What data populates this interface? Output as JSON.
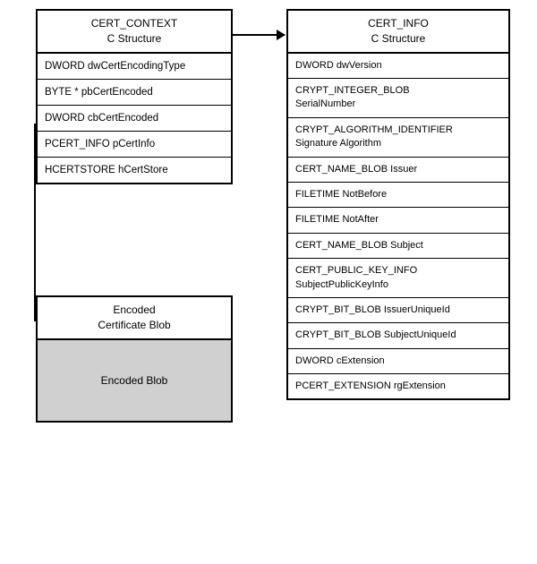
{
  "certContext": {
    "title": "CERT_CONTEXT",
    "subtitle": "C Structure",
    "rows": [
      "DWORD  dwCertEncodingType",
      "BYTE *  pbCertEncoded",
      "DWORD  cbCertEncoded",
      "PCERT_INFO  pCertInfo",
      "HCERTSTORE  hCertStore"
    ]
  },
  "encodedCertBlob": {
    "title": "Encoded",
    "title2": "Certificate Blob",
    "blobLabel": "Encoded Blob"
  },
  "certInfo": {
    "title": "CERT_INFO",
    "subtitle": "C Structure",
    "rows": [
      "DWORD  dwVersion",
      "CRYPT_INTEGER_BLOB\nSerialNumber",
      "CRYPT_ALGORITHM_IDENTIFIER\nSignature Algorithm",
      "CERT_NAME_BLOB  Issuer",
      "FILETIME  NotBefore",
      "FILETIME  NotAfter",
      "CERT_NAME_BLOB  Subject",
      "CERT_PUBLIC_KEY_INFO\nSubjectPublicKeyInfo",
      "CRYPT_BIT_BLOB  IssuerUniqueId",
      "CRYPT_BIT_BLOB  SubjectUniqueId",
      "DWORD  cExtension",
      "PCERT_EXTENSION  rgExtension"
    ]
  }
}
